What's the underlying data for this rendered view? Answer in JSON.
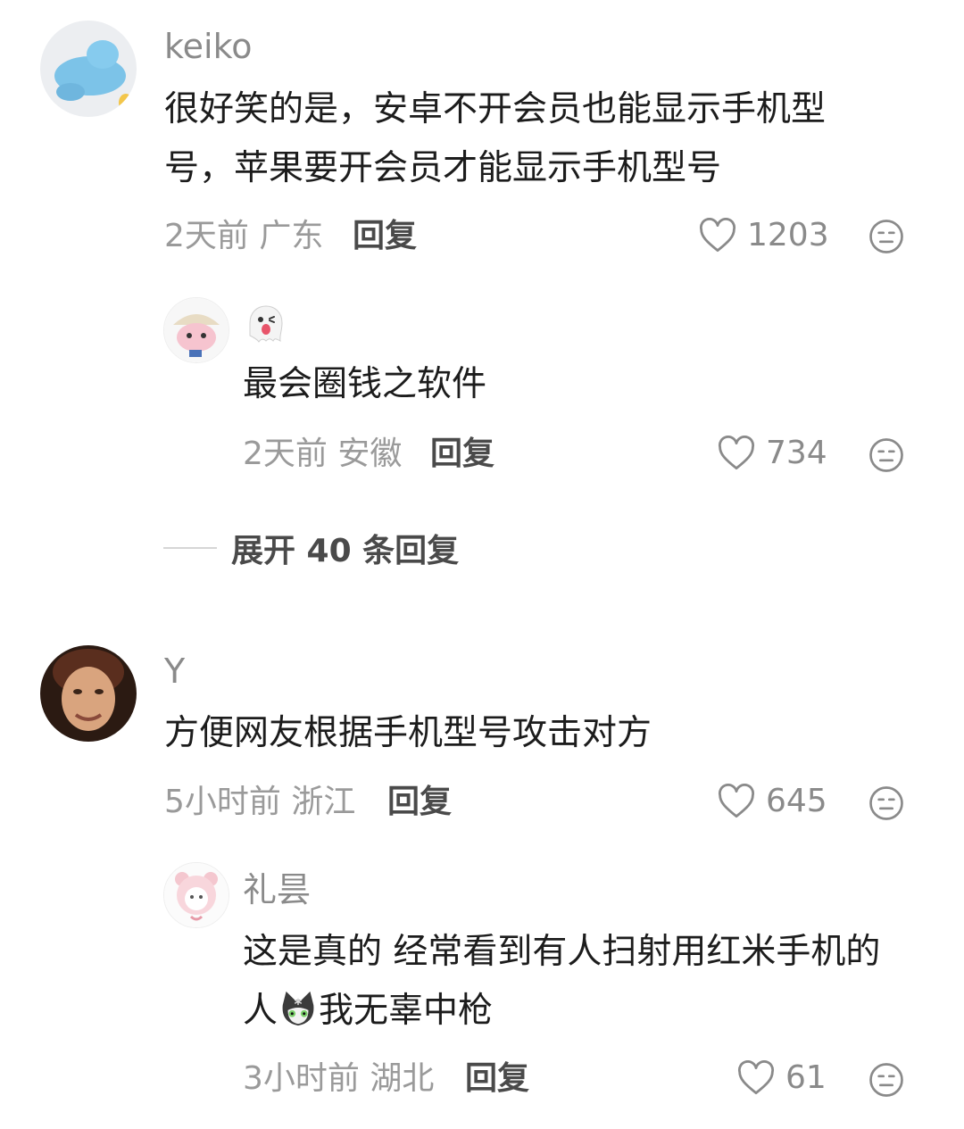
{
  "comments": [
    {
      "username": "keiko",
      "text": "很好笑的是，安卓不开会员也能显示手机型号，苹果要开会员才能显示手机型号",
      "line1": "很好笑的是，安卓不开会员也能显示手机型",
      "line2": "号，苹果要开会员才能显示手机型号",
      "time_location": "2天前 广东",
      "reply_label": "回复",
      "likes": "1203",
      "avatar": "blue-plush-avatar",
      "replies": [
        {
          "username_emoji": "ghost-emoji",
          "text": "最会圈钱之软件",
          "time_location": "2天前 安徽",
          "reply_label": "回复",
          "likes": "734",
          "avatar": "cartoon-pig-avatar"
        }
      ],
      "expand_label": "展开 40 条回复"
    },
    {
      "username": "Y",
      "text": "方便网友根据手机型号攻击对方",
      "time_location": "5小时前 浙江",
      "reply_label": "回复",
      "likes": "645",
      "avatar": "man-photo-avatar",
      "replies": [
        {
          "username": "礼昙",
          "line1": "这是真的 经常看到有人扫射用红米手机的",
          "line2_a": "人",
          "line2_b": "我无辜中枪",
          "inline_emoji": "cat-emoji",
          "time_location": "3小时前 湖北",
          "reply_label": "回复",
          "likes": "61",
          "avatar": "pink-bear-avatar"
        }
      ]
    }
  ],
  "colors": {
    "meta": "#9a9a9a",
    "text": "#1c1c1c",
    "icon": "#8a8a8a"
  }
}
